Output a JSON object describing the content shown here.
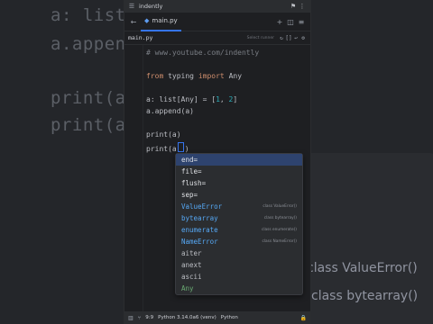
{
  "background": {
    "code_lines": [
      "a: list",
      "a.append",
      "print(a",
      "print(a"
    ],
    "ghost_items": [
      "class ValueError()",
      "class bytearray()"
    ]
  },
  "window": {
    "title": "indently",
    "titlebar_icons": {
      "left": "hamburger-icon",
      "right": [
        "run-icon",
        "more-icon"
      ]
    }
  },
  "tabbar": {
    "tab_label": "main.py",
    "icons": [
      "back-arrow-icon",
      "plus-icon",
      "split-icon",
      "menu-icon"
    ]
  },
  "crumbbar": {
    "file": "main.py",
    "select_hint": "Select runner",
    "icons": [
      "refresh-icon",
      "brackets-icon",
      "wrap-icon",
      "settings-icon"
    ]
  },
  "code": {
    "comment": "# www.youtube.com/indently",
    "import_from": "from",
    "import_module": "typing",
    "import_kw": "import",
    "import_name": "Any",
    "decl_pre": "a: list[Any] = [",
    "decl_n1": "1",
    "decl_sep": ", ",
    "decl_n2": "2",
    "decl_post": "]",
    "append_line": "a.append(a)",
    "print1": "print(a)",
    "print2_pre": "print(a",
    "print2_post": ")"
  },
  "completions": [
    {
      "name": "end=",
      "kind": "kwarg",
      "hint": ""
    },
    {
      "name": "file=",
      "kind": "kwarg",
      "hint": ""
    },
    {
      "name": "flush=",
      "kind": "kwarg",
      "hint": ""
    },
    {
      "name": "sep=",
      "kind": "kwarg",
      "hint": ""
    },
    {
      "name": "ValueError",
      "kind": "class",
      "hint": "class ValueError()"
    },
    {
      "name": "bytearray",
      "kind": "class",
      "hint": "class bytearray()"
    },
    {
      "name": "enumerate",
      "kind": "class",
      "hint": "class enumerate()"
    },
    {
      "name": "NameError",
      "kind": "class",
      "hint": "class NameError()"
    },
    {
      "name": "aiter",
      "kind": "fn",
      "hint": ""
    },
    {
      "name": "anext",
      "kind": "fn",
      "hint": ""
    },
    {
      "name": "ascii",
      "kind": "fn",
      "hint": ""
    },
    {
      "name": "Any",
      "kind": "any",
      "hint": ""
    }
  ],
  "selected_completion_index": 0,
  "status": {
    "position": "9:9",
    "interpreter": "Python 3.14.0a6 (venv)",
    "language": "Python"
  },
  "colors": {
    "accent": "#3574f0",
    "selection": "#2e436e",
    "keyword": "#cf8e6d",
    "number": "#2aacb8"
  }
}
